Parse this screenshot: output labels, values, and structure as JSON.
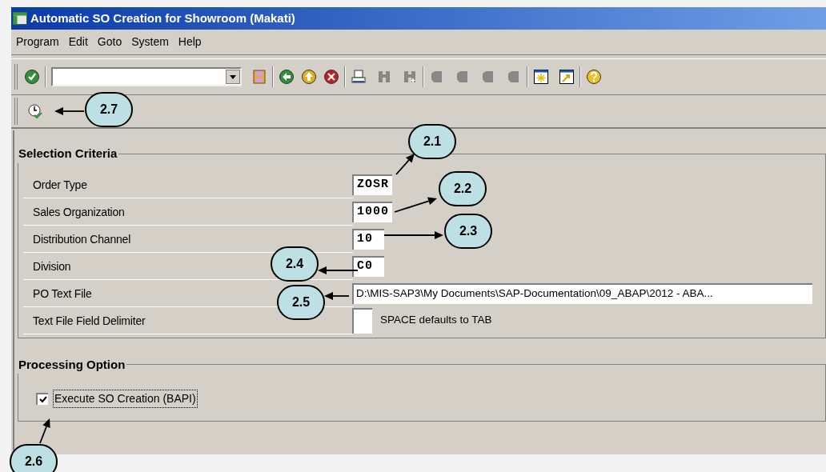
{
  "window": {
    "title": "Automatic SO Creation for Showroom (Makati)"
  },
  "menu": [
    "Program",
    "Edit",
    "Goto",
    "System",
    "Help"
  ],
  "selection_criteria": {
    "title": "Selection Criteria",
    "rows": [
      {
        "label": "Order Type",
        "value": "ZOSR",
        "kind": "code"
      },
      {
        "label": "Sales Organization",
        "value": "1000",
        "kind": "code"
      },
      {
        "label": "Distribution Channel",
        "value": "10",
        "kind": "code"
      },
      {
        "label": "Division",
        "value": "C0",
        "kind": "code"
      },
      {
        "label": "PO Text File",
        "value": "D:\\MIS-SAP3\\My Documents\\SAP-Documentation\\09_ABAP\\2012 - ABA...",
        "kind": "path"
      },
      {
        "label": "Text File Field Delimiter",
        "value": "",
        "kind": "delimiter",
        "note": "SPACE defaults to TAB"
      }
    ]
  },
  "processing_option": {
    "title": "Processing Option",
    "checkbox": {
      "label": "Execute SO Creation (BAPI)",
      "checked": true,
      "focused": true
    }
  },
  "callouts": [
    {
      "label": "2.1"
    },
    {
      "label": "2.2"
    },
    {
      "label": "2.3"
    },
    {
      "label": "2.4"
    },
    {
      "label": "2.5"
    },
    {
      "label": "2.6"
    },
    {
      "label": "2.7"
    }
  ]
}
